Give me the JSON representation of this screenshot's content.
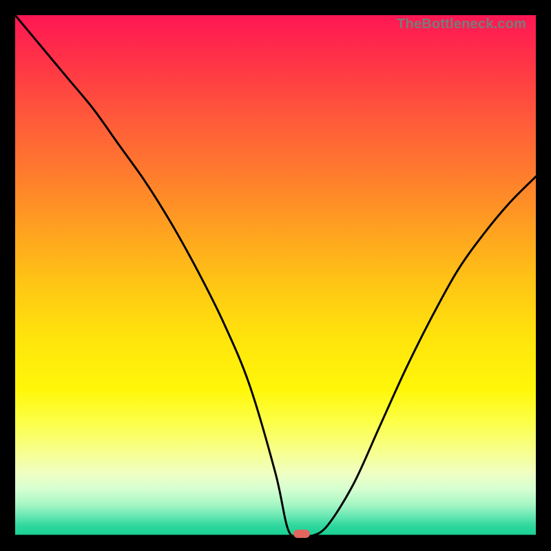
{
  "attribution": "TheBottleneck.com",
  "chart_data": {
    "type": "line",
    "title": "",
    "xlabel": "",
    "ylabel": "",
    "xlim": [
      0,
      100
    ],
    "ylim": [
      0,
      100
    ],
    "x": [
      0,
      5,
      10,
      15,
      20,
      25,
      30,
      35,
      40,
      45,
      50,
      52.5,
      55,
      57,
      60,
      65,
      70,
      75,
      80,
      85,
      90,
      95,
      100
    ],
    "values": [
      100,
      94,
      88,
      82,
      75,
      68,
      60,
      51,
      41,
      29,
      12,
      1,
      0,
      0,
      2,
      10,
      21,
      32,
      42,
      51,
      58,
      64,
      69
    ],
    "marker": {
      "x": 55,
      "y": 0
    },
    "gradient_stops": [
      {
        "pos": 0,
        "color": "#ff1754"
      },
      {
        "pos": 8,
        "color": "#ff3048"
      },
      {
        "pos": 20,
        "color": "#ff5a3a"
      },
      {
        "pos": 30,
        "color": "#ff7a2e"
      },
      {
        "pos": 42,
        "color": "#ffa41f"
      },
      {
        "pos": 52,
        "color": "#ffc714"
      },
      {
        "pos": 62,
        "color": "#ffe40c"
      },
      {
        "pos": 72,
        "color": "#fff70a"
      },
      {
        "pos": 78,
        "color": "#fcff46"
      },
      {
        "pos": 84,
        "color": "#f7ff90"
      },
      {
        "pos": 88,
        "color": "#efffc3"
      },
      {
        "pos": 91,
        "color": "#d6ffd1"
      },
      {
        "pos": 94,
        "color": "#a6f6c4"
      },
      {
        "pos": 96,
        "color": "#6de8b5"
      },
      {
        "pos": 98,
        "color": "#30d89e"
      },
      {
        "pos": 100,
        "color": "#17d092"
      }
    ]
  },
  "colors": {
    "frame": "#000000",
    "curve": "#000000",
    "marker": "#e2655f",
    "attribution": "#7a7a7a"
  }
}
